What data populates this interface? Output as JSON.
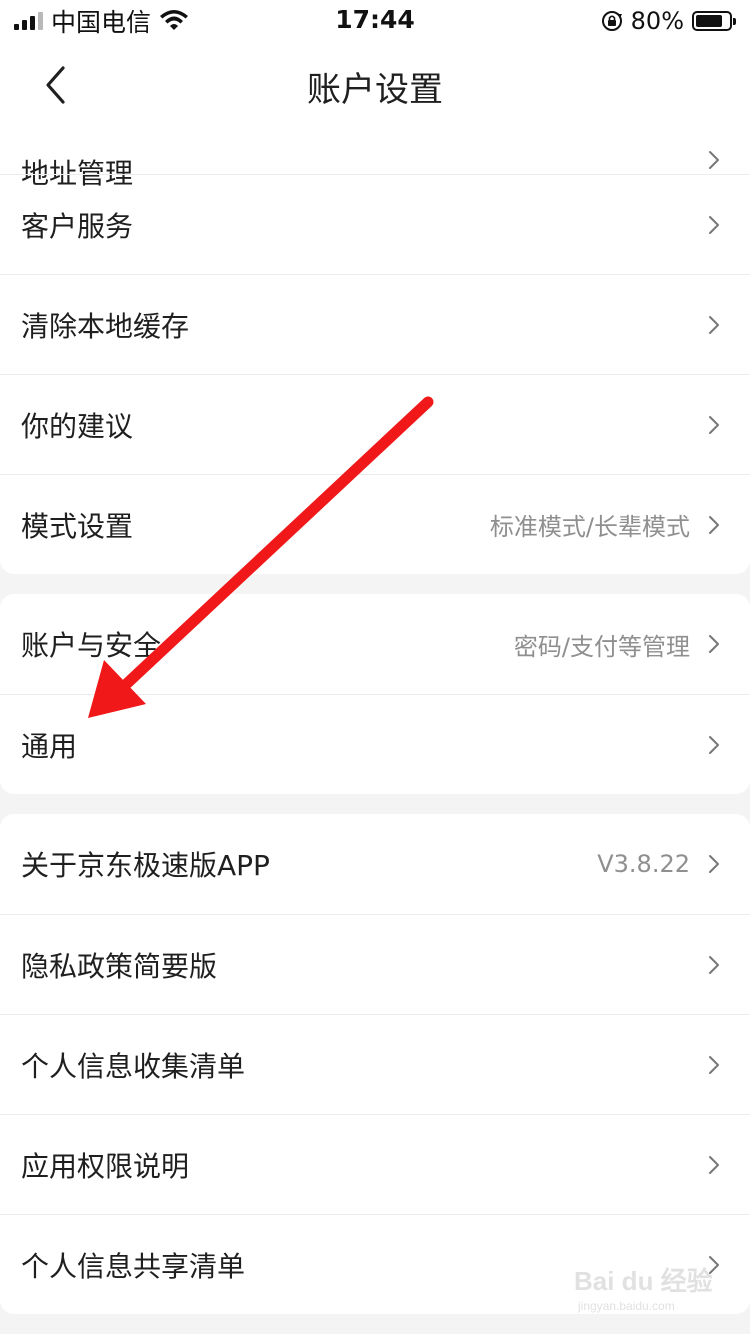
{
  "status_bar": {
    "carrier": "中国电信",
    "time": "17:44",
    "battery_percent": "80%",
    "battery_level": 0.8,
    "signal_bars_active": 3,
    "signal_bars_total": 4
  },
  "nav": {
    "title": "账户设置",
    "back_icon": "chevron-left-icon"
  },
  "groups": [
    {
      "rows": [
        {
          "label": "地址管理",
          "value": "",
          "partial": true
        },
        {
          "label": "客户服务",
          "value": ""
        },
        {
          "label": "清除本地缓存",
          "value": ""
        },
        {
          "label": "你的建议",
          "value": ""
        },
        {
          "label": "模式设置",
          "value": "标准模式/长辈模式"
        }
      ]
    },
    {
      "rows": [
        {
          "label": "账户与安全",
          "value": "密码/支付等管理"
        },
        {
          "label": "通用",
          "value": ""
        }
      ]
    },
    {
      "rows": [
        {
          "label": "关于京东极速版APP",
          "value": "V3.8.22"
        },
        {
          "label": "隐私政策简要版",
          "value": ""
        },
        {
          "label": "个人信息收集清单",
          "value": ""
        },
        {
          "label": "应用权限说明",
          "value": ""
        },
        {
          "label": "个人信息共享清单",
          "value": ""
        }
      ]
    }
  ],
  "watermark": {
    "logo_text": "Bai du 经验",
    "url_text": "jingyan.baidu.com"
  },
  "colors": {
    "annotation_arrow": "#f01818",
    "background": "#f4f4f4",
    "row_bg": "#ffffff",
    "value_text": "#8f8f8f"
  }
}
